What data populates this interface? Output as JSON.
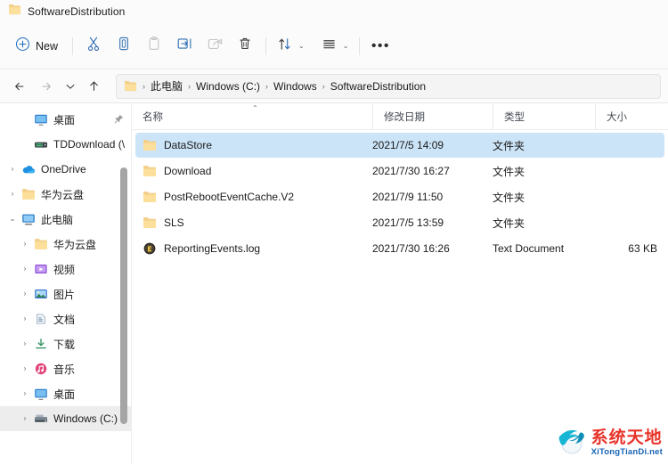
{
  "window": {
    "title": "SoftwareDistribution",
    "title_icon": "folder-icon"
  },
  "toolbar": {
    "new_label": "New",
    "new_icon": "plus-circle-icon",
    "buttons": [
      {
        "name": "cut",
        "icon": "scissors-icon",
        "disabled": false
      },
      {
        "name": "copy",
        "icon": "copy-icon",
        "disabled": false
      },
      {
        "name": "paste",
        "icon": "clipboard-icon",
        "disabled": true
      },
      {
        "name": "rename",
        "icon": "rename-icon",
        "disabled": false
      },
      {
        "name": "share",
        "icon": "share-icon",
        "disabled": true
      },
      {
        "name": "delete",
        "icon": "trash-icon",
        "disabled": false
      }
    ],
    "sort_icon": "sort-arrows-icon",
    "view_icon": "view-lines-icon",
    "more_icon": "ellipsis-icon",
    "chevron": "⌄"
  },
  "addressbar": {
    "back_icon": "arrow-left-icon",
    "forward_icon": "arrow-right-icon",
    "recent_icon": "chevron-down-icon",
    "up_icon": "arrow-up-icon",
    "path_icon": "folder-icon",
    "separator": "›",
    "crumbs": [
      "此电脑",
      "Windows (C:)",
      "Windows",
      "SoftwareDistribution"
    ]
  },
  "sidebar": {
    "items": [
      {
        "label": "桌面",
        "icon": "desktop-icon",
        "expander": "",
        "indent": 1,
        "pinned": true,
        "selected": false
      },
      {
        "label": "TDDownload (\\",
        "icon": "network-drive-icon",
        "expander": "",
        "indent": 1,
        "pinned": false,
        "selected": false
      },
      {
        "label": "OneDrive",
        "icon": "onedrive-cloud-icon",
        "expander": "›",
        "indent": 0,
        "pinned": false,
        "selected": false
      },
      {
        "label": "华为云盘",
        "icon": "folder-icon",
        "expander": "›",
        "indent": 0,
        "pinned": false,
        "selected": false
      },
      {
        "label": "此电脑",
        "icon": "this-pc-icon",
        "expander": "⌄",
        "indent": 0,
        "pinned": false,
        "selected": false
      },
      {
        "label": "华为云盘",
        "icon": "folder-icon",
        "expander": "›",
        "indent": 1,
        "pinned": false,
        "selected": false
      },
      {
        "label": "视频",
        "icon": "videos-icon",
        "expander": "›",
        "indent": 1,
        "pinned": false,
        "selected": false
      },
      {
        "label": "图片",
        "icon": "pictures-icon",
        "expander": "›",
        "indent": 1,
        "pinned": false,
        "selected": false
      },
      {
        "label": "文档",
        "icon": "documents-icon",
        "expander": "›",
        "indent": 1,
        "pinned": false,
        "selected": false
      },
      {
        "label": "下载",
        "icon": "downloads-icon",
        "expander": "›",
        "indent": 1,
        "pinned": false,
        "selected": false
      },
      {
        "label": "音乐",
        "icon": "music-icon",
        "expander": "›",
        "indent": 1,
        "pinned": false,
        "selected": false
      },
      {
        "label": "桌面",
        "icon": "desktop-icon",
        "expander": "›",
        "indent": 1,
        "pinned": false,
        "selected": false
      },
      {
        "label": "Windows (C:)",
        "icon": "local-disk-icon",
        "expander": "›",
        "indent": 1,
        "pinned": false,
        "selected": true
      }
    ]
  },
  "filelist": {
    "columns": [
      {
        "key": "name",
        "label": "名称",
        "sorted": "asc",
        "caret": "⌃"
      },
      {
        "key": "date",
        "label": "修改日期",
        "sorted": "",
        "caret": ""
      },
      {
        "key": "type",
        "label": "类型",
        "sorted": "",
        "caret": ""
      },
      {
        "key": "size",
        "label": "大小",
        "sorted": "",
        "caret": ""
      }
    ],
    "rows": [
      {
        "name": "DataStore",
        "date": "2021/7/5 14:09",
        "type": "文件夹",
        "size": "",
        "icon": "folder-icon",
        "selected": true
      },
      {
        "name": "Download",
        "date": "2021/7/30 16:27",
        "type": "文件夹",
        "size": "",
        "icon": "folder-icon",
        "selected": false
      },
      {
        "name": "PostRebootEventCache.V2",
        "date": "2021/7/9 11:50",
        "type": "文件夹",
        "size": "",
        "icon": "folder-icon",
        "selected": false
      },
      {
        "name": "SLS",
        "date": "2021/7/5 13:59",
        "type": "文件夹",
        "size": "",
        "icon": "folder-icon",
        "selected": false
      },
      {
        "name": "ReportingEvents.log",
        "date": "2021/7/30 16:26",
        "type": "Text Document",
        "size": "63 KB",
        "icon": "log-file-icon",
        "selected": false
      }
    ]
  },
  "watermark": {
    "cn": "系统天地",
    "en": "XiTongTianDi.net",
    "icon": "globe-swoosh-logo"
  },
  "colors": {
    "selection": "#cce4f8",
    "accent": "#0f6cbd",
    "folder": "#ffd166",
    "watermark_red": "#e8332a",
    "watermark_blue": "#1763b5"
  }
}
